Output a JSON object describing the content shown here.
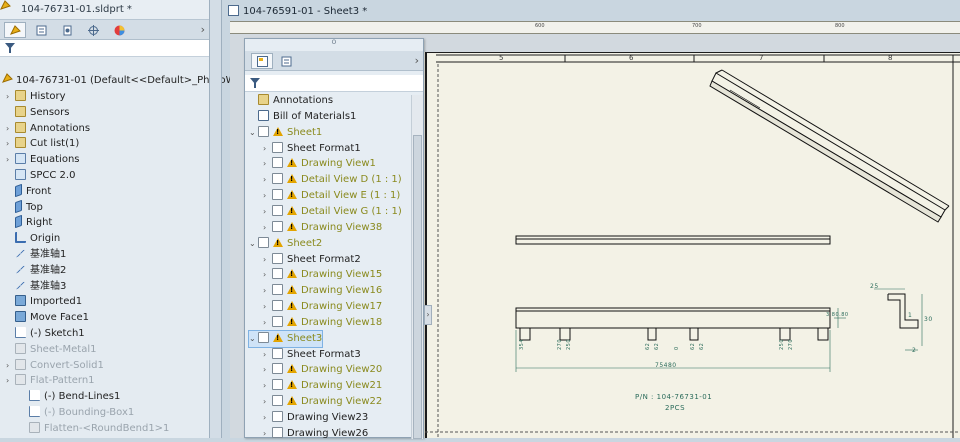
{
  "part": {
    "title": "104-76731-01.sldprt *",
    "root_label": "104-76731-01  (Default<<Default>_PhotoW",
    "tree": [
      {
        "label": "History",
        "icon": "history-icon",
        "style": "normal",
        "exp": true
      },
      {
        "label": "Sensors",
        "icon": "sensors-icon",
        "style": "normal",
        "exp": false
      },
      {
        "label": "Annotations",
        "icon": "annotations-icon",
        "style": "normal",
        "exp": true
      },
      {
        "label": "Cut list(1)",
        "icon": "cut-list-icon",
        "style": "normal",
        "exp": true
      },
      {
        "label": "Equations",
        "icon": "equations-icon",
        "style": "normal",
        "exp": true
      },
      {
        "label": "SPCC 2.0",
        "icon": "material-icon",
        "style": "normal",
        "exp": false
      },
      {
        "label": "Front",
        "icon": "plane-icon",
        "style": "normal",
        "exp": false
      },
      {
        "label": "Top",
        "icon": "plane-icon",
        "style": "normal",
        "exp": false
      },
      {
        "label": "Right",
        "icon": "plane-icon",
        "style": "normal",
        "exp": false
      },
      {
        "label": "Origin",
        "icon": "origin-icon",
        "style": "normal",
        "exp": false
      },
      {
        "label": "基准轴1",
        "icon": "axis-icon",
        "style": "normal",
        "exp": false
      },
      {
        "label": "基准轴2",
        "icon": "axis-icon",
        "style": "normal",
        "exp": false
      },
      {
        "label": "基准轴3",
        "icon": "axis-icon",
        "style": "normal",
        "exp": false
      },
      {
        "label": "Imported1",
        "icon": "imported-icon",
        "style": "normal",
        "exp": false
      },
      {
        "label": "Move Face1",
        "icon": "move-face-icon",
        "style": "normal",
        "exp": false
      },
      {
        "label": "(-) Sketch1",
        "icon": "sketch-icon",
        "style": "normal",
        "exp": false
      },
      {
        "label": "Sheet-Metal1",
        "icon": "sheet-metal-icon",
        "style": "dim",
        "exp": false
      },
      {
        "label": "Convert-Solid1",
        "icon": "convert-solid-icon",
        "style": "dim",
        "exp": true
      },
      {
        "label": "Flat-Pattern1",
        "icon": "flat-pattern-icon",
        "style": "dim",
        "exp": true
      },
      {
        "label": "(-) Bend-Lines1",
        "icon": "sketch-icon",
        "style": "child",
        "exp": false
      },
      {
        "label": "(-) Bounding-Box1",
        "icon": "sketch-icon",
        "style": "childdim",
        "exp": false
      },
      {
        "label": "Flatten-<RoundBend1>1",
        "icon": "flatten-icon",
        "style": "childdim",
        "exp": false
      }
    ]
  },
  "drawing": {
    "tab_title": "104-76591-01 - Sheet3 *",
    "tree": [
      {
        "label": "Annotations",
        "kind": "annotations",
        "indent": 0,
        "exp": false,
        "warn": false,
        "style": "normal"
      },
      {
        "label": "Bill of Materials1",
        "kind": "bom",
        "indent": 0,
        "exp": false,
        "warn": false,
        "style": "normal"
      },
      {
        "label": "Sheet1",
        "kind": "sheet",
        "indent": 0,
        "exp": "open",
        "warn": true,
        "style": "warn"
      },
      {
        "label": "Sheet Format1",
        "kind": "format",
        "indent": 1,
        "exp": true,
        "warn": false,
        "style": "normal"
      },
      {
        "label": "Drawing View1",
        "kind": "view",
        "indent": 1,
        "exp": true,
        "warn": true,
        "style": "warn"
      },
      {
        "label": "Detail View D (1 : 1)",
        "kind": "detail",
        "indent": 1,
        "exp": true,
        "warn": true,
        "style": "warn"
      },
      {
        "label": "Detail View E (1 : 1)",
        "kind": "detail",
        "indent": 1,
        "exp": true,
        "warn": true,
        "style": "warn"
      },
      {
        "label": "Detail View G (1 : 1)",
        "kind": "detail",
        "indent": 1,
        "exp": true,
        "warn": true,
        "style": "warn"
      },
      {
        "label": "Drawing View38",
        "kind": "view",
        "indent": 1,
        "exp": true,
        "warn": true,
        "style": "warn"
      },
      {
        "label": "Sheet2",
        "kind": "sheet",
        "indent": 0,
        "exp": "open",
        "warn": true,
        "style": "warn"
      },
      {
        "label": "Sheet Format2",
        "kind": "format",
        "indent": 1,
        "exp": true,
        "warn": false,
        "style": "normal"
      },
      {
        "label": "Drawing View15",
        "kind": "view",
        "indent": 1,
        "exp": true,
        "warn": true,
        "style": "warn"
      },
      {
        "label": "Drawing View16",
        "kind": "view",
        "indent": 1,
        "exp": true,
        "warn": true,
        "style": "warn"
      },
      {
        "label": "Drawing View17",
        "kind": "view",
        "indent": 1,
        "exp": true,
        "warn": true,
        "style": "warn"
      },
      {
        "label": "Drawing View18",
        "kind": "view",
        "indent": 1,
        "exp": true,
        "warn": true,
        "style": "warn"
      },
      {
        "label": "Sheet3",
        "kind": "sheet",
        "indent": 0,
        "exp": "open",
        "warn": true,
        "style": "selwarn"
      },
      {
        "label": "Sheet Format3",
        "kind": "format",
        "indent": 1,
        "exp": true,
        "warn": false,
        "style": "normal"
      },
      {
        "label": "Drawing View20",
        "kind": "view",
        "indent": 1,
        "exp": true,
        "warn": true,
        "style": "warn"
      },
      {
        "label": "Drawing View21",
        "kind": "view",
        "indent": 1,
        "exp": true,
        "warn": true,
        "style": "warn"
      },
      {
        "label": "Drawing View22",
        "kind": "view",
        "indent": 1,
        "exp": true,
        "warn": true,
        "style": "warn"
      },
      {
        "label": "Drawing View23",
        "kind": "view",
        "indent": 1,
        "exp": true,
        "warn": false,
        "style": "normal"
      },
      {
        "label": "Drawing View26",
        "kind": "view",
        "indent": 1,
        "exp": true,
        "warn": false,
        "style": "normal"
      }
    ],
    "zones": [
      "5",
      "6",
      "7",
      "8"
    ],
    "ruler_labels": [
      "600",
      "700",
      "800"
    ],
    "dims_bottom": [
      "354",
      "270",
      "250",
      "62",
      "62",
      "0",
      "62",
      "62",
      "250",
      "270",
      "3 80.80"
    ],
    "overall_dim": "75480",
    "right_dims": [
      "25",
      "1",
      "30",
      "2"
    ],
    "pn_line": "P/N : 104-76731-01",
    "qty_line": "2PCS"
  }
}
